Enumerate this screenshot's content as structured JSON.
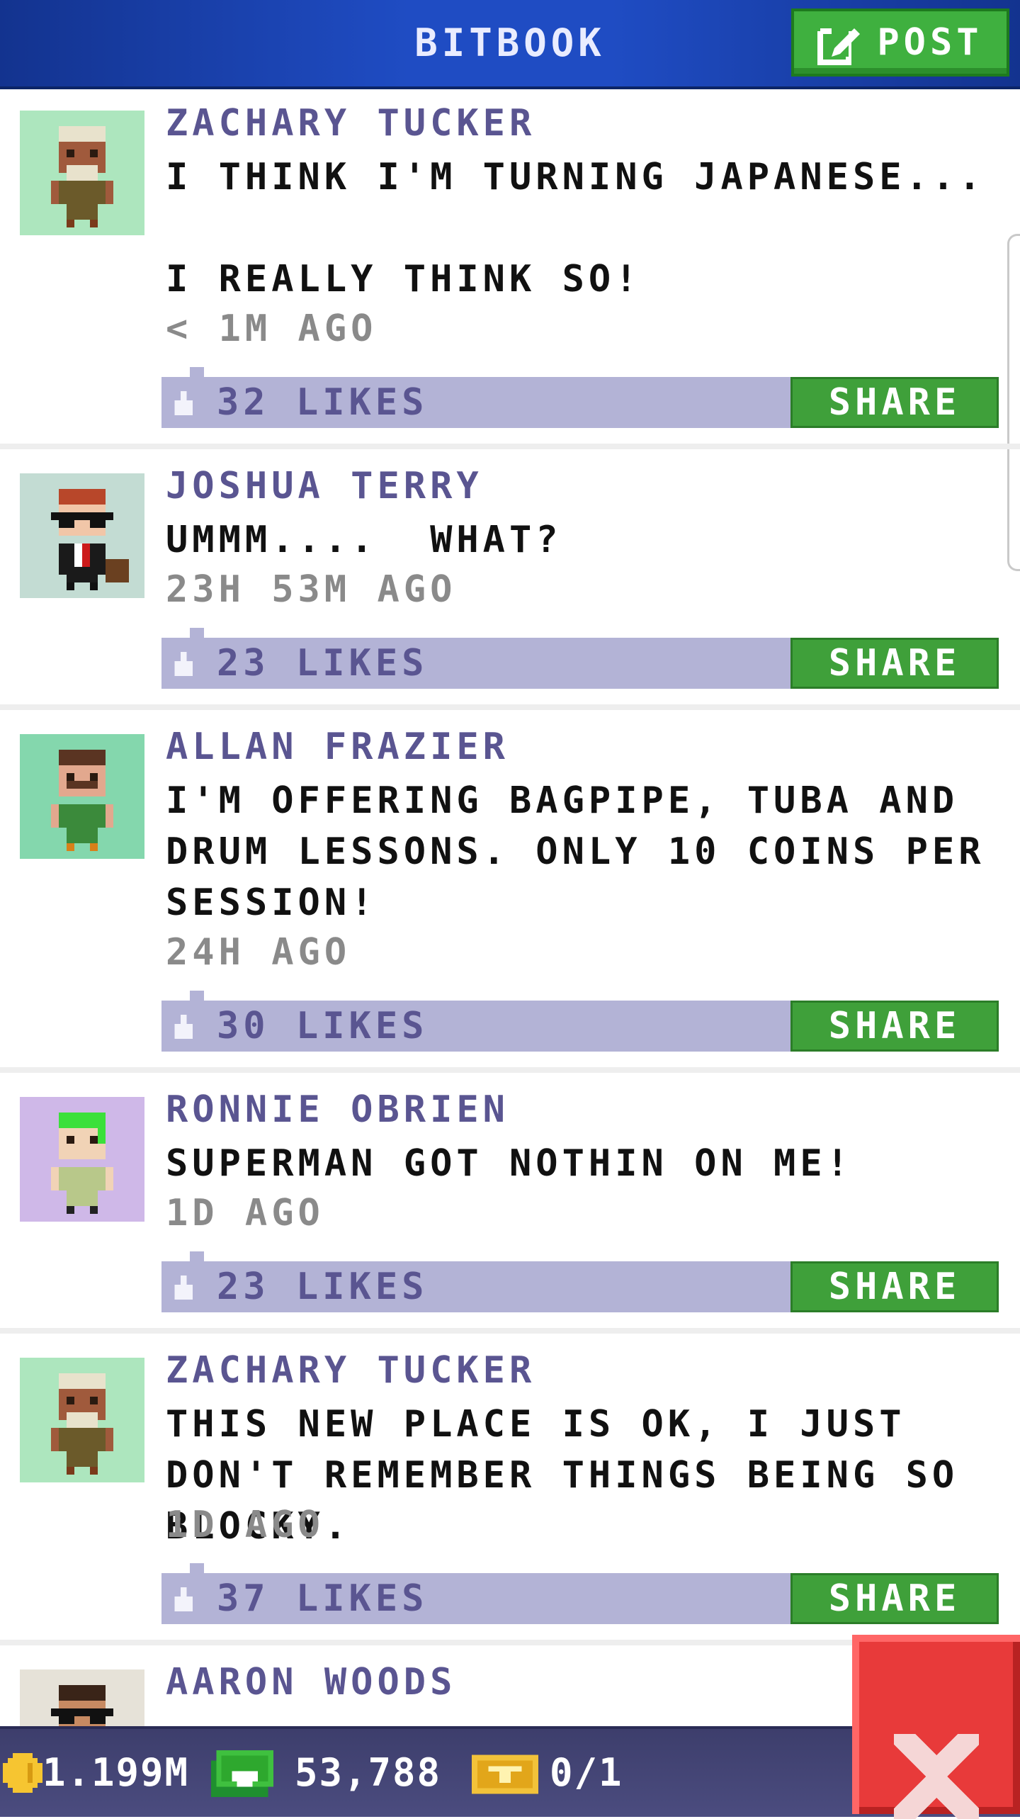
{
  "header": {
    "title": "BITBOOK",
    "post_label": "POST"
  },
  "posts": [
    {
      "name": "ZACHARY TUCKER",
      "message": "I THINK I'M TURNING JAPANESE...\n\nI REALLY THINK SO!",
      "time": "< 1M AGO",
      "likes": "32 LIKES",
      "share": "SHARE"
    },
    {
      "name": "JOSHUA TERRY",
      "message": "UMMM....  WHAT?",
      "time": "23H 53M AGO",
      "likes": "23 LIKES",
      "share": "SHARE"
    },
    {
      "name": "ALLAN FRAZIER",
      "message": "I'M OFFERING BAGPIPE, TUBA AND DRUM LESSONS. ONLY 10 COINS PER SESSION!",
      "time": "24H AGO",
      "likes": "30 LIKES",
      "share": "SHARE"
    },
    {
      "name": "RONNIE OBRIEN",
      "message": "SUPERMAN GOT NOTHIN ON ME!",
      "time": "1D AGO",
      "likes": "23 LIKES",
      "share": "SHARE"
    },
    {
      "name": "ZACHARY TUCKER",
      "message": "THIS NEW PLACE IS OK, I JUST DON'T REMEMBER THINGS BEING SO BLOCKY.",
      "time": "1D AGO",
      "likes": "37 LIKES",
      "share": "SHARE"
    },
    {
      "name": "AARON WOODS"
    }
  ],
  "bottom_bar": {
    "coins": "1.199M",
    "bux": "53,788",
    "tickets": "0/1"
  },
  "colors": {
    "header": "#1f4cc3",
    "post_button": "#3fb03f",
    "like_bar": "#b3b3d6",
    "share_button": "#3fa03a",
    "close_button": "#e83a3a",
    "name_text": "#5a5591"
  }
}
